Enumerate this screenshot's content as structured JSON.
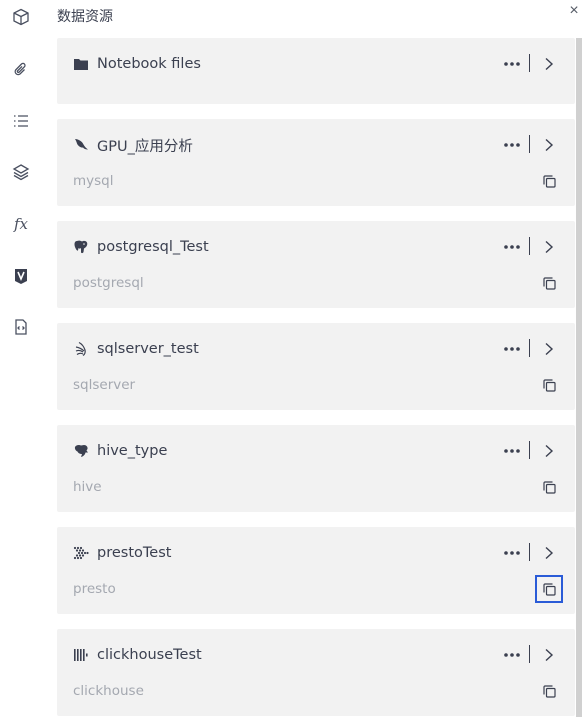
{
  "sidebar": {
    "items": [
      {
        "icon": "cube-icon"
      },
      {
        "icon": "paperclip-icon"
      },
      {
        "icon": "list-icon"
      },
      {
        "icon": "layers-icon"
      },
      {
        "icon": "fx-icon",
        "label": "fx"
      },
      {
        "icon": "v-logo-icon"
      },
      {
        "icon": "code-file-icon"
      }
    ]
  },
  "panel": {
    "title": "数据资源",
    "close_label": "×"
  },
  "resources": [
    {
      "name": "Notebook files",
      "type": "",
      "icon": "folder-icon"
    },
    {
      "name": "GPU_应用分析",
      "type": "mysql",
      "icon": "mysql-icon"
    },
    {
      "name": "postgresql_Test",
      "type": "postgresql",
      "icon": "postgresql-icon"
    },
    {
      "name": "sqlserver_test",
      "type": "sqlserver",
      "icon": "sqlserver-icon"
    },
    {
      "name": "hive_type",
      "type": "hive",
      "icon": "hive-icon"
    },
    {
      "name": "prestoTest",
      "type": "presto",
      "icon": "presto-icon"
    },
    {
      "name": "clickhouseTest",
      "type": "clickhouse",
      "icon": "clickhouse-icon"
    }
  ],
  "colors": {
    "text": "#3b4050",
    "subtext": "#a4a8b0",
    "card_bg": "#f2f2f2",
    "focus": "#2a5bd7"
  }
}
